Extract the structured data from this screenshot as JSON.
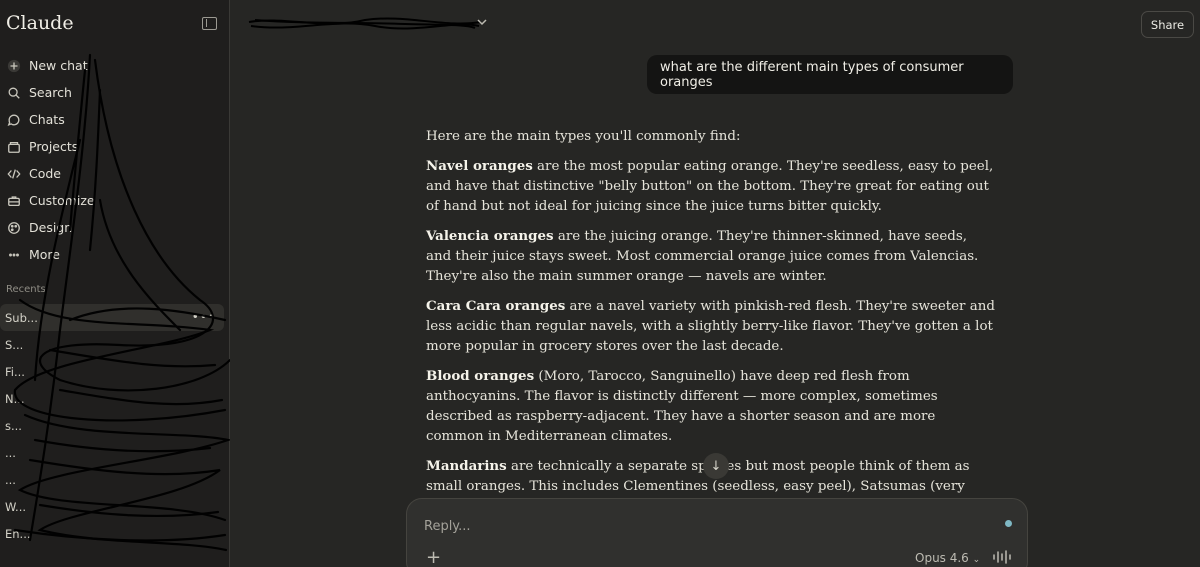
{
  "sidebar": {
    "brand": "Claude",
    "nav": [
      {
        "label": "New chat",
        "icon": "plus-icon"
      },
      {
        "label": "Search",
        "icon": "search-icon"
      },
      {
        "label": "Chats",
        "icon": "chat-bubble-icon"
      },
      {
        "label": "Projects",
        "icon": "folder-icon"
      },
      {
        "label": "Code",
        "icon": "code-icon"
      },
      {
        "label": "Customize",
        "icon": "briefcase-icon"
      },
      {
        "label": "Design",
        "icon": "palette-icon"
      },
      {
        "label": "More",
        "icon": "more-icon"
      }
    ],
    "section_label": "Recents",
    "recents": [
      {
        "label": "Sub..."
      },
      {
        "label": "S..."
      },
      {
        "label": "Fi..."
      },
      {
        "label": "N..."
      },
      {
        "label": "s..."
      },
      {
        "label": "..."
      },
      {
        "label": "..."
      },
      {
        "label": "W..."
      },
      {
        "label": "En..."
      }
    ]
  },
  "header": {
    "title": "",
    "share_label": "Share"
  },
  "chat": {
    "user_message": "what are the different main types of consumer oranges",
    "response": {
      "intro": "Here are the main types you'll commonly find:",
      "sections": [
        {
          "bold": "Navel oranges",
          "text": " are the most popular eating orange. They're seedless, easy to peel, and have that distinctive \"belly button\" on the bottom. They're great for eating out of hand but not ideal for juicing since the juice turns bitter quickly."
        },
        {
          "bold": "Valencia oranges",
          "text": " are the juicing orange. They're thinner-skinned, have seeds, and their juice stays sweet. Most commercial orange juice comes from Valencias. They're also the main summer orange — navels are winter."
        },
        {
          "bold": "Cara Cara oranges",
          "text": " are a navel variety with pinkish-red flesh. They're sweeter and less acidic than regular navels, with a slightly berry-like flavor. They've gotten a lot more popular in grocery stores over the last decade."
        },
        {
          "bold": "Blood oranges",
          "text": " (Moro, Tarocco, Sanguinello) have deep red flesh from anthocyanins. The flavor is distinctly different — more complex, sometimes described as raspberry-adjacent. They have a shorter season and are more common in Mediterranean climates."
        },
        {
          "bold": "Mandarins",
          "text": " are technically a separate species but most people think of them as small oranges. This includes Clementines (seedless, easy peel), Satsumas (very tender, cold-hardy), and Tangerines. Cuties and Halos are brand names for Clementines and sometimes"
        }
      ]
    }
  },
  "composer": {
    "placeholder": "Reply...",
    "model": "Opus 4.6",
    "status_color": "#7fb8c4"
  }
}
